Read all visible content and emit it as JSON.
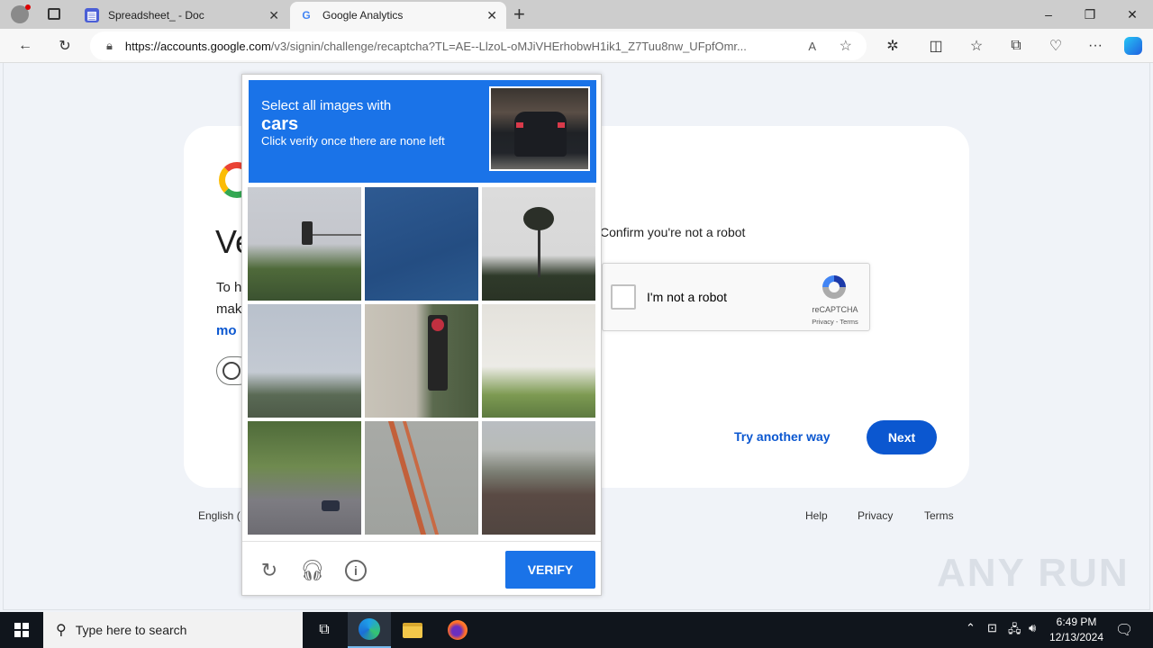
{
  "browser": {
    "tabs": [
      {
        "label": "Spreadsheet_ - Doc",
        "active": false
      },
      {
        "label": "Google Analytics",
        "active": true
      }
    ],
    "new_tab_label": "+",
    "url_host": "https://accounts.google.com",
    "url_path": "/v3/signin/challenge/recaptcha?TL=AE--LlzoL-oMJiVHErhobwH1ik1_Z7Tuu8nw_UFpfOmr...",
    "window_controls": {
      "minimize": "–",
      "restore": "❐",
      "close": "✕"
    }
  },
  "signin_page": {
    "heading_partial": "Ve",
    "body_line1_partial": "To h",
    "body_line2_partial": "mak",
    "learn_more_partial": "mo",
    "confirm_text": "Confirm you're not a robot",
    "recaptcha": {
      "checkbox_label": "I'm not a robot",
      "brand": "reCAPTCHA",
      "links": "Privacy - Terms"
    },
    "try_another_way": "Try another way",
    "next_button": "Next",
    "footer": {
      "language_partial": "English (",
      "help": "Help",
      "privacy": "Privacy",
      "terms": "Terms"
    }
  },
  "challenge": {
    "instruction_line1": "Select all images with",
    "target": "cars",
    "instruction_line3": "Click verify once there are none left",
    "tiles": [
      {
        "desc": "traffic light and trees"
      },
      {
        "desc": "blue sky"
      },
      {
        "desc": "palm tree"
      },
      {
        "desc": "palm trees on skyline"
      },
      {
        "desc": "building with traffic light"
      },
      {
        "desc": "white house with palms"
      },
      {
        "desc": "street with parked cars"
      },
      {
        "desc": "ladder against wall"
      },
      {
        "desc": "house roof"
      }
    ],
    "icons": {
      "reload": "reload-icon",
      "audio": "headphones-icon",
      "info": "info-icon"
    },
    "verify_button": "VERIFY"
  },
  "taskbar": {
    "search_placeholder": "Type here to search",
    "time": "6:49 PM",
    "date": "12/13/2024"
  },
  "watermark": "ANY RUN"
}
